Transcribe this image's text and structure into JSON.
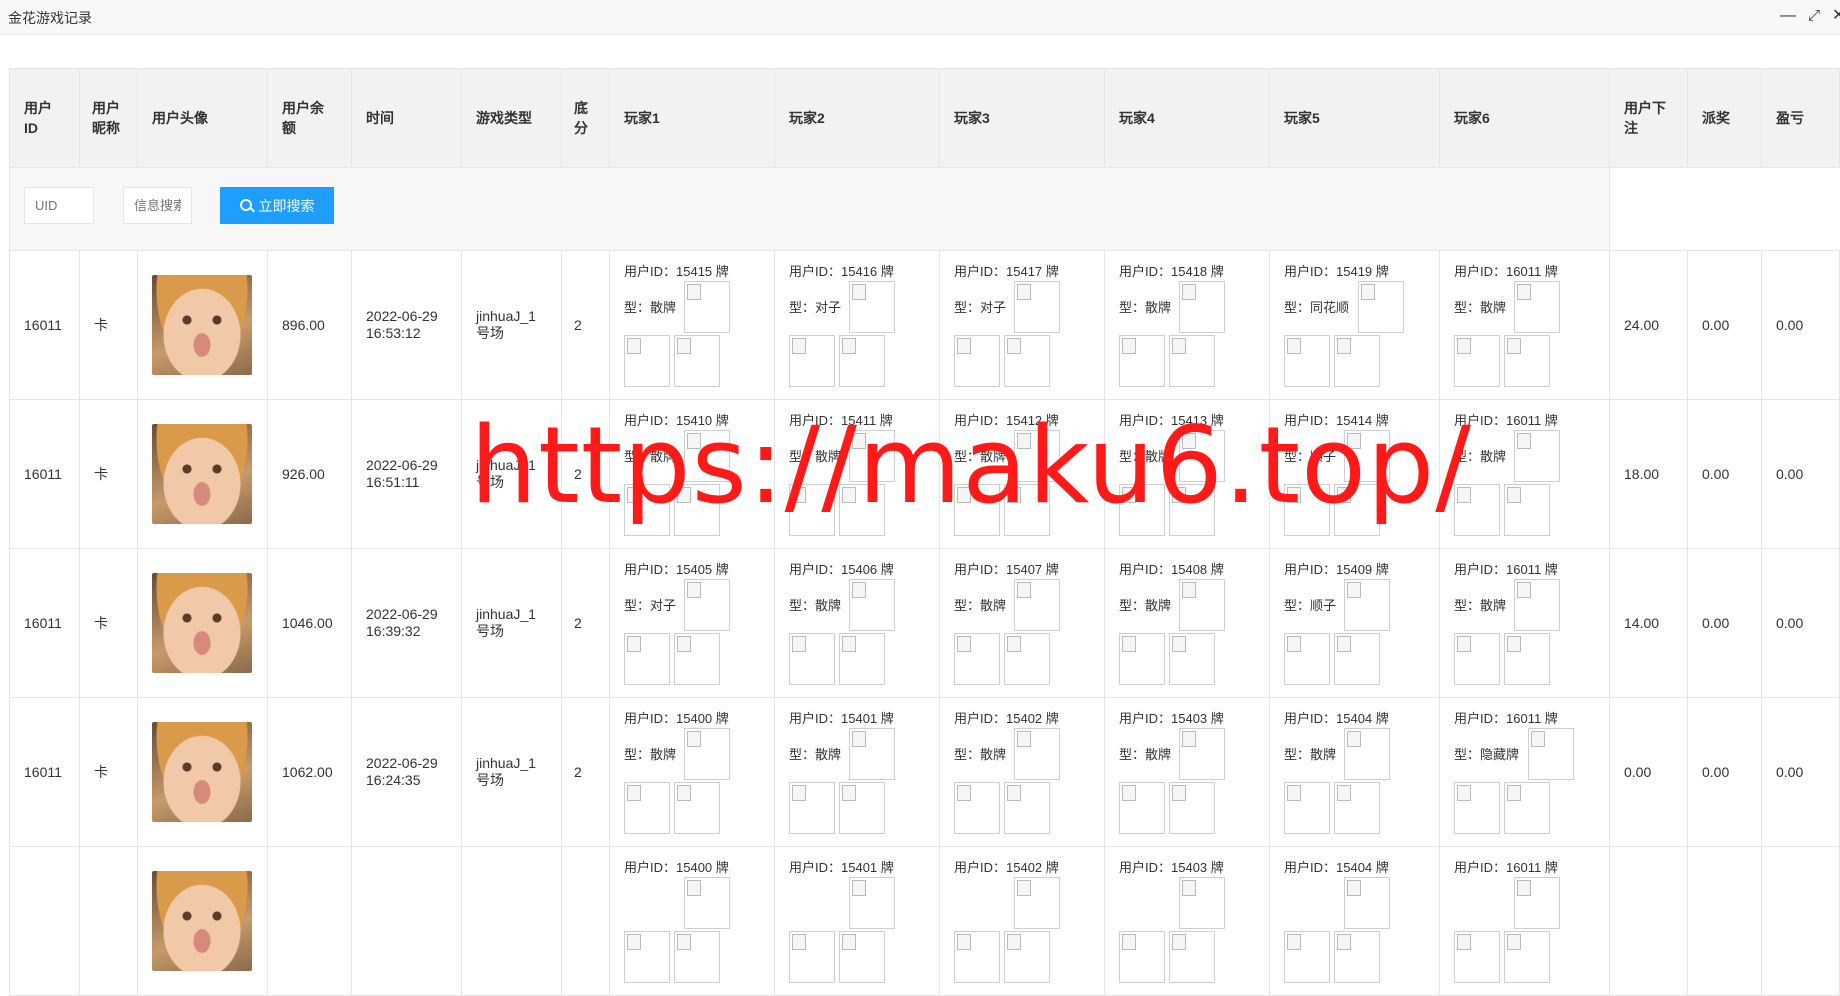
{
  "window": {
    "title": "金花游戏记录",
    "controls": {
      "minimize": "—",
      "maximize": "⤢",
      "close": "✕"
    }
  },
  "table": {
    "headers": [
      "用户ID",
      "用户昵称",
      "用户头像",
      "用户余额",
      "时间",
      "游戏类型",
      "底分",
      "玩家1",
      "玩家2",
      "玩家3",
      "玩家4",
      "玩家5",
      "玩家6",
      "用户下注",
      "派奖",
      "盈亏"
    ],
    "search": {
      "uid_placeholder": "UID",
      "info_placeholder": "信息搜索",
      "button_label": "立即搜索"
    },
    "rows": [
      {
        "uid": "16011",
        "nickname": "卡",
        "avatar": "child-photo",
        "balance": "896.00",
        "time": "2022-06-29 16:53:12",
        "game_type": "jinhuaJ_1号场",
        "base": "2",
        "players": [
          {
            "id_text": "用户ID：15415 牌",
            "type_text": "型：散牌"
          },
          {
            "id_text": "用户ID：15416 牌",
            "type_text": "型：对子"
          },
          {
            "id_text": "用户ID：15417 牌",
            "type_text": "型：对子"
          },
          {
            "id_text": "用户ID：15418 牌",
            "type_text": "型：散牌"
          },
          {
            "id_text": "用户ID：15419 牌",
            "type_text": "型：同花顺"
          },
          {
            "id_text": "用户ID：16011 牌",
            "type_text": "型：散牌"
          }
        ],
        "bet": "24.00",
        "payout": "0.00",
        "profit": "0.00"
      },
      {
        "uid": "16011",
        "nickname": "卡",
        "avatar": "child-photo",
        "balance": "926.00",
        "time": "2022-06-29 16:51:11",
        "game_type": "jinhuaJ_1号场",
        "base": "2",
        "players": [
          {
            "id_text": "用户ID：15410 牌",
            "type_text": "型：散牌"
          },
          {
            "id_text": "用户ID：15411 牌",
            "type_text": "型：散牌"
          },
          {
            "id_text": "用户ID：15412 牌",
            "type_text": "型：散牌"
          },
          {
            "id_text": "用户ID：15413 牌",
            "type_text": "型：散牌"
          },
          {
            "id_text": "用户ID：15414 牌",
            "type_text": "型：顺子"
          },
          {
            "id_text": "用户ID：16011 牌",
            "type_text": "型：散牌"
          }
        ],
        "bet": "18.00",
        "payout": "0.00",
        "profit": "0.00"
      },
      {
        "uid": "16011",
        "nickname": "卡",
        "avatar": "child-photo",
        "balance": "1046.00",
        "time": "2022-06-29 16:39:32",
        "game_type": "jinhuaJ_1号场",
        "base": "2",
        "players": [
          {
            "id_text": "用户ID：15405 牌",
            "type_text": "型：对子"
          },
          {
            "id_text": "用户ID：15406 牌",
            "type_text": "型：散牌"
          },
          {
            "id_text": "用户ID：15407 牌",
            "type_text": "型：散牌"
          },
          {
            "id_text": "用户ID：15408 牌",
            "type_text": "型：散牌"
          },
          {
            "id_text": "用户ID：15409 牌",
            "type_text": "型：顺子"
          },
          {
            "id_text": "用户ID：16011 牌",
            "type_text": "型：散牌"
          }
        ],
        "bet": "14.00",
        "payout": "0.00",
        "profit": "0.00"
      },
      {
        "uid": "16011",
        "nickname": "卡",
        "avatar": "child-photo",
        "balance": "1062.00",
        "time": "2022-06-29 16:24:35",
        "game_type": "jinhuaJ_1号场",
        "base": "2",
        "players": [
          {
            "id_text": "用户ID：15400 牌",
            "type_text": "型：散牌"
          },
          {
            "id_text": "用户ID：15401 牌",
            "type_text": "型：散牌"
          },
          {
            "id_text": "用户ID：15402 牌",
            "type_text": "型：散牌"
          },
          {
            "id_text": "用户ID：15403 牌",
            "type_text": "型：散牌"
          },
          {
            "id_text": "用户ID：15404 牌",
            "type_text": "型：散牌"
          },
          {
            "id_text": "用户ID：16011 牌",
            "type_text": "型：隐藏牌"
          }
        ],
        "bet": "0.00",
        "payout": "0.00",
        "profit": "0.00"
      },
      {
        "uid": "",
        "nickname": "",
        "avatar": "child-photo",
        "balance": "",
        "time": "",
        "game_type": "",
        "base": "",
        "players": [
          {
            "id_text": "用户ID：15400 牌",
            "type_text": ""
          },
          {
            "id_text": "用户ID：15401 牌",
            "type_text": ""
          },
          {
            "id_text": "用户ID：15402 牌",
            "type_text": ""
          },
          {
            "id_text": "用户ID：15403 牌",
            "type_text": ""
          },
          {
            "id_text": "用户ID：15404 牌",
            "type_text": ""
          },
          {
            "id_text": "用户ID：16011 牌",
            "type_text": ""
          }
        ],
        "bet": "",
        "payout": "",
        "profit": ""
      }
    ]
  },
  "watermark": "https://maku6.top/"
}
